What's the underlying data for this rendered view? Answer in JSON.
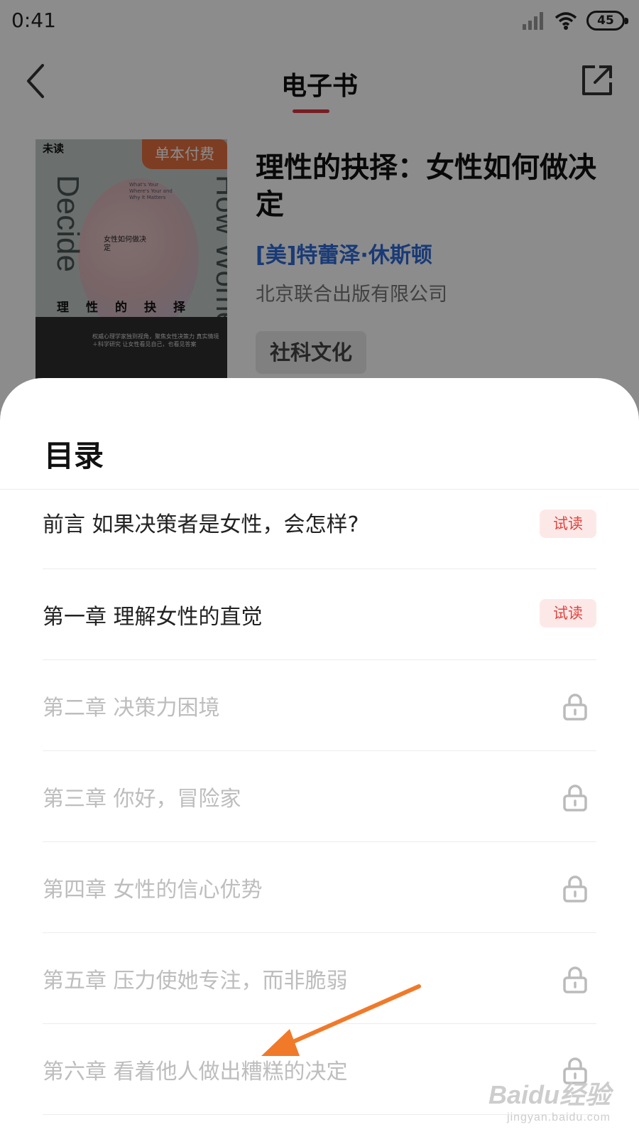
{
  "status_bar": {
    "time": "0:41",
    "battery": "45"
  },
  "nav": {
    "title": "电子书"
  },
  "book": {
    "cover": {
      "publisher_mark": "未读",
      "title_en_left": "Decide",
      "title_en_right": "How Women",
      "small_text": "What's Your Where's Your and Why It Matters",
      "subtitle_zh": "女性如何做决定",
      "title_zh": "理性的抉择",
      "blurb": "权威心理学家独到视角，聚焦女性决策力 真实情境＋科学研究 让女性看见自己，也看见答案"
    },
    "tag": "单本付费",
    "title": "理性的抉择：女性如何做决定",
    "author": "[美]特蕾泽·休斯顿",
    "publisher": "北京联合出版有限公司",
    "category": "社科文化"
  },
  "toc": {
    "title": "目录",
    "trial_label": "试读",
    "items": [
      {
        "label": "前言 如果决策者是女性，会怎样?",
        "locked": false
      },
      {
        "label": "第一章 理解女性的直觉",
        "locked": false
      },
      {
        "label": "第二章 决策力困境",
        "locked": true
      },
      {
        "label": "第三章 你好，冒险家",
        "locked": true
      },
      {
        "label": "第四章 女性的信心优势",
        "locked": true
      },
      {
        "label": "第五章 压力使她专注，而非脆弱",
        "locked": true
      },
      {
        "label": "第六章 看着他人做出糟糕的决定",
        "locked": true
      }
    ]
  },
  "watermark": {
    "main": "Baidu经验",
    "sub": "jingyan.baidu.com"
  },
  "colors": {
    "accent_red": "#d9363e",
    "author_blue": "#2f6bd8",
    "tag_orange": "#e36f3f",
    "arrow_orange": "#f07a2a"
  }
}
